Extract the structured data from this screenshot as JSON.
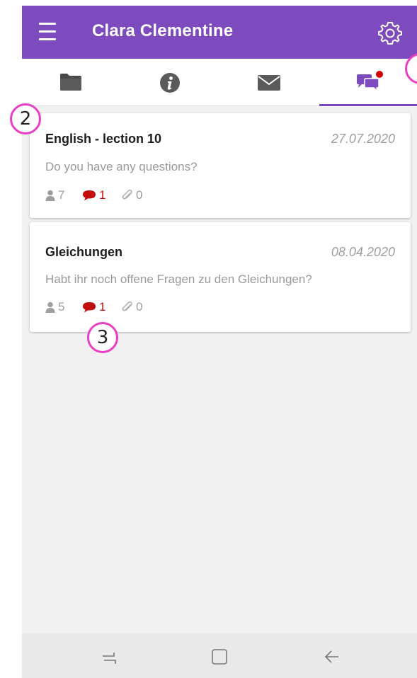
{
  "app": {
    "title": "Clara Clementine",
    "accent": "#7e4bbf"
  },
  "appbar": {
    "menu_icon": "hamburger-icon",
    "settings_icon": "gear-icon"
  },
  "tabs": [
    {
      "icon": "folder-icon",
      "active": false
    },
    {
      "icon": "info-icon",
      "active": false
    },
    {
      "icon": "envelope-icon",
      "active": false
    },
    {
      "icon": "chat-icon",
      "active": true,
      "notification_dot": true
    }
  ],
  "threads": [
    {
      "title": "English - lection 10",
      "date": "27.07.2020",
      "message": "Do you have any questions?",
      "participants": "7",
      "comments": "1",
      "attachments": "0"
    },
    {
      "title": "Gleichungen",
      "date": "08.04.2020",
      "message": "Habt ihr noch offene Fragen zu den Gleichungen?",
      "participants": "5",
      "comments": "1",
      "attachments": "0"
    }
  ],
  "annotations": {
    "marker_2": "2",
    "marker_3": "3"
  },
  "system_nav": {
    "recents_icon": "recents-icon",
    "home_icon": "home-icon",
    "back_icon": "back-icon"
  }
}
